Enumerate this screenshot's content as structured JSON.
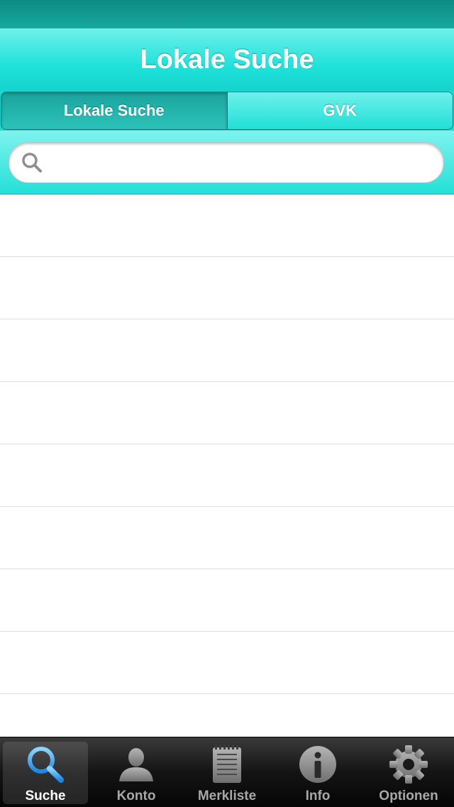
{
  "nav": {
    "title": "Lokale Suche"
  },
  "segments": [
    {
      "label": "Lokale Suche",
      "selected": true
    },
    {
      "label": "GVK",
      "selected": false
    }
  ],
  "search": {
    "value": "",
    "placeholder": ""
  },
  "list": {
    "rows": 9
  },
  "tabbar": {
    "items": [
      {
        "label": "Suche",
        "icon": "magnifier-icon",
        "selected": true
      },
      {
        "label": "Konto",
        "icon": "person-icon",
        "selected": false
      },
      {
        "label": "Merkliste",
        "icon": "notepad-icon",
        "selected": false
      },
      {
        "label": "Info",
        "icon": "info-icon",
        "selected": false
      },
      {
        "label": "Optionen",
        "icon": "gear-icon",
        "selected": false
      }
    ]
  },
  "colors": {
    "accent": "#1fe2da",
    "status_bar": "#0e8a84",
    "selected_tab_icon": "#3aa6f0"
  }
}
